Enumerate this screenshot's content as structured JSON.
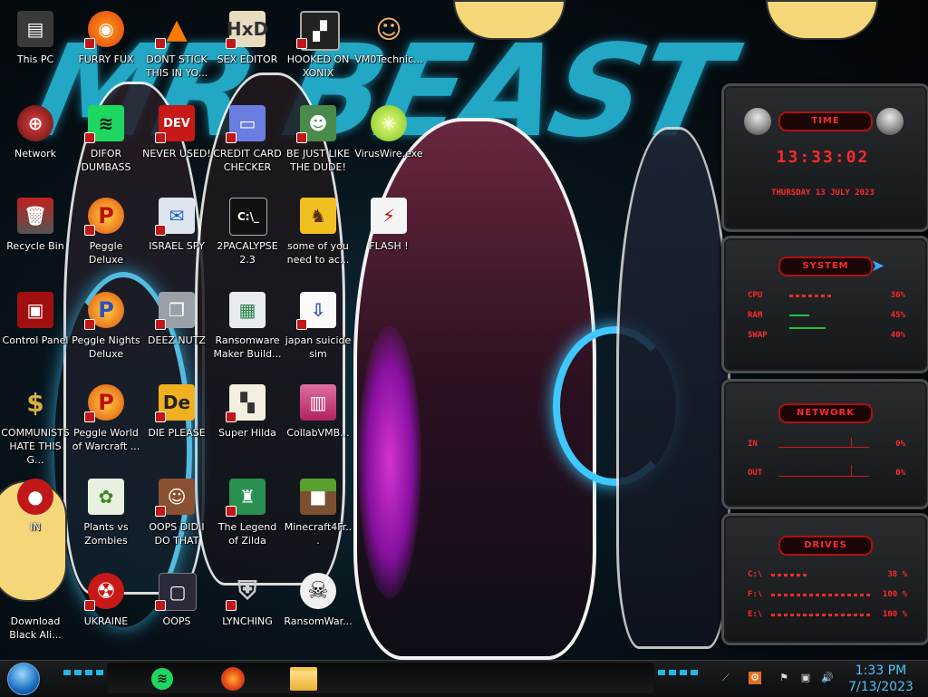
{
  "desktop": {
    "icons": [
      {
        "label": "This PC"
      },
      {
        "label": "FURRY FUX"
      },
      {
        "label": "DONT STICK THIS IN YO..."
      },
      {
        "label": "SEX EDITOR"
      },
      {
        "label": "HOOKED ON XONIX"
      },
      {
        "label": "VM0Technic..."
      },
      {
        "label": "Network"
      },
      {
        "label": "DIFOR DUMBASS"
      },
      {
        "label": "NEVER USED!"
      },
      {
        "label": "CREDIT CARD CHECKER"
      },
      {
        "label": "BE JUST LIKE THE DUDE!"
      },
      {
        "label": "VirusWire.exe"
      },
      {
        "label": "Recycle Bin"
      },
      {
        "label": "Peggle Deluxe"
      },
      {
        "label": "ISRAEL SPY"
      },
      {
        "label": "2PACALYPSE 2.3"
      },
      {
        "label": "some of you need to ac..."
      },
      {
        "label": "FLASH !"
      },
      {
        "label": "Control Panel"
      },
      {
        "label": "Peggle Nights Deluxe"
      },
      {
        "label": "DEEZ NUTZ"
      },
      {
        "label": "Ransomware Maker Build..."
      },
      {
        "label": "japan suicide sim"
      },
      {
        "label": "COMMUNISTS HATE THIS G..."
      },
      {
        "label": "Peggle World of Warcraft ..."
      },
      {
        "label": "DIE PLEASE"
      },
      {
        "label": "Super Hilda"
      },
      {
        "label": "CollabVMB..."
      },
      {
        "label": "IN"
      },
      {
        "label": "Plants vs Zombies"
      },
      {
        "label": "OOPS DID I DO THAT"
      },
      {
        "label": "The Legend of Zilda"
      },
      {
        "label": "Minecraft4Fr..."
      },
      {
        "label": "Download Black Ali..."
      },
      {
        "label": "UKRAINE"
      },
      {
        "label": "OOPS"
      },
      {
        "label": "LYNCHING"
      },
      {
        "label": "RansomWar..."
      }
    ]
  },
  "wallpaper": {
    "banner_text": "MR BEAST"
  },
  "widgets": {
    "time": {
      "title": "TIME",
      "clock": "13:33:02",
      "date": "THURSDAY 13 JULY 2023"
    },
    "system": {
      "title": "SYSTEM",
      "cpu_label": "CPU",
      "cpu_value": "36%",
      "cpu_level": 0.36,
      "ram_label": "RAM",
      "ram_value": "45%",
      "ram_level": 0.45,
      "swap_label": "SWAP",
      "swap_value": "40%",
      "swap_level": 0.4
    },
    "network": {
      "title": "NETWORK",
      "in_label": "IN",
      "in_value": "0%",
      "out_label": "OUT",
      "out_value": "0%"
    },
    "drives": {
      "title": "DRIVES",
      "c_label": "C:\\",
      "c_value": "38 %",
      "c_level": 0.38,
      "f_label": "F:\\",
      "f_value": "100 %",
      "f_level": 1.0,
      "e_label": "E:\\",
      "e_value": "100 %",
      "e_level": 1.0
    }
  },
  "taskbar": {
    "apps": [
      {
        "name": "spotify-icon"
      },
      {
        "name": "firefox-icon"
      },
      {
        "name": "file-explorer-icon"
      }
    ],
    "clock_time": "1:33 PM",
    "clock_date": "7/13/2023"
  },
  "colors": {
    "accent_red": "#ff2a2a",
    "wallpaper_cyan": "#26b8d8",
    "clock_text": "#4fc3f7"
  }
}
